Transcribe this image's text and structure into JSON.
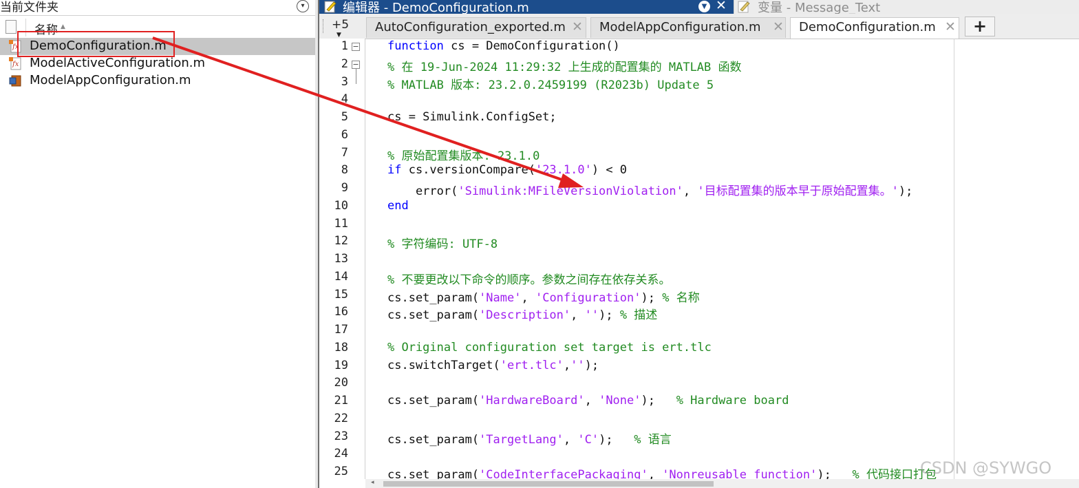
{
  "file_browser": {
    "title": "当前文件夹",
    "column_name": "名称",
    "files": [
      {
        "name": "DemoConfiguration.m",
        "icon": "matlab-function-icon",
        "selected": true
      },
      {
        "name": "ModelActiveConfiguration.m",
        "icon": "matlab-function-icon",
        "selected": false
      },
      {
        "name": "ModelAppConfiguration.m",
        "icon": "matlab-class-icon",
        "selected": false
      }
    ]
  },
  "editor": {
    "title": "编辑器 - DemoConfiguration.m",
    "variable_panel_title": "变量 - Message_Text",
    "more_tabs": "+5",
    "tabs": [
      {
        "label": "AutoConfiguration_exported.m",
        "active": false
      },
      {
        "label": "ModelAppConfiguration.m",
        "active": false
      },
      {
        "label": "DemoConfiguration.m",
        "active": true
      }
    ],
    "add_tab": "+"
  },
  "code": {
    "lines": [
      {
        "n": "1",
        "parts": [
          {
            "c": "kw",
            "t": "function"
          },
          {
            "c": "",
            "t": " cs = DemoConfiguration()"
          }
        ]
      },
      {
        "n": "2",
        "parts": [
          {
            "c": "cm",
            "t": "% 在 19-Jun-2024 11:29:32 上生成的配置集的 MATLAB 函数"
          }
        ]
      },
      {
        "n": "3",
        "parts": [
          {
            "c": "cm",
            "t": "% MATLAB 版本: 23.2.0.2459199 (R2023b) Update 5"
          }
        ]
      },
      {
        "n": "4",
        "parts": []
      },
      {
        "n": "5",
        "parts": [
          {
            "c": "",
            "t": "cs = Simulink.ConfigSet;"
          }
        ]
      },
      {
        "n": "6",
        "parts": []
      },
      {
        "n": "7",
        "parts": [
          {
            "c": "cm",
            "t": "% 原始配置集版本: 23.1.0"
          }
        ]
      },
      {
        "n": "8",
        "parts": [
          {
            "c": "kw",
            "t": "if"
          },
          {
            "c": "",
            "t": " cs.versionCompare("
          },
          {
            "c": "st",
            "t": "'23.1.0'"
          },
          {
            "c": "",
            "t": ") < 0"
          }
        ]
      },
      {
        "n": "9",
        "parts": [
          {
            "c": "",
            "t": "    error("
          },
          {
            "c": "st",
            "t": "'Simulink:MFileVersionViolation'"
          },
          {
            "c": "",
            "t": ", "
          },
          {
            "c": "st",
            "t": "'目标配置集的版本早于原始配置集。'"
          },
          {
            "c": "",
            "t": ");"
          }
        ]
      },
      {
        "n": "10",
        "parts": [
          {
            "c": "kw",
            "t": "end"
          }
        ]
      },
      {
        "n": "11",
        "parts": []
      },
      {
        "n": "12",
        "parts": [
          {
            "c": "cm",
            "t": "% 字符编码: UTF-8"
          }
        ]
      },
      {
        "n": "13",
        "parts": []
      },
      {
        "n": "14",
        "parts": [
          {
            "c": "cm",
            "t": "% 不要更改以下命令的顺序。参数之间存在依存关系。"
          }
        ]
      },
      {
        "n": "15",
        "parts": [
          {
            "c": "",
            "t": "cs.set_param("
          },
          {
            "c": "st",
            "t": "'Name'"
          },
          {
            "c": "",
            "t": ", "
          },
          {
            "c": "st",
            "t": "'Configuration'"
          },
          {
            "c": "",
            "t": "); "
          },
          {
            "c": "cm",
            "t": "% 名称"
          }
        ]
      },
      {
        "n": "16",
        "parts": [
          {
            "c": "",
            "t": "cs.set_param("
          },
          {
            "c": "st",
            "t": "'Description'"
          },
          {
            "c": "",
            "t": ", "
          },
          {
            "c": "st",
            "t": "''"
          },
          {
            "c": "",
            "t": "); "
          },
          {
            "c": "cm",
            "t": "% 描述"
          }
        ]
      },
      {
        "n": "17",
        "parts": []
      },
      {
        "n": "18",
        "parts": [
          {
            "c": "cm",
            "t": "% Original configuration set target is ert.tlc"
          }
        ]
      },
      {
        "n": "19",
        "parts": [
          {
            "c": "",
            "t": "cs.switchTarget("
          },
          {
            "c": "st",
            "t": "'ert.tlc'"
          },
          {
            "c": "",
            "t": ","
          },
          {
            "c": "st",
            "t": "''"
          },
          {
            "c": "",
            "t": ");"
          }
        ]
      },
      {
        "n": "20",
        "parts": []
      },
      {
        "n": "21",
        "parts": [
          {
            "c": "",
            "t": "cs.set_param("
          },
          {
            "c": "st",
            "t": "'HardwareBoard'"
          },
          {
            "c": "",
            "t": ", "
          },
          {
            "c": "st",
            "t": "'None'"
          },
          {
            "c": "",
            "t": ");   "
          },
          {
            "c": "cm",
            "t": "% Hardware board"
          }
        ]
      },
      {
        "n": "22",
        "parts": []
      },
      {
        "n": "23",
        "parts": [
          {
            "c": "",
            "t": "cs.set_param("
          },
          {
            "c": "st",
            "t": "'TargetLang'"
          },
          {
            "c": "",
            "t": ", "
          },
          {
            "c": "st",
            "t": "'C'"
          },
          {
            "c": "",
            "t": ");   "
          },
          {
            "c": "cm",
            "t": "% 语言"
          }
        ]
      },
      {
        "n": "24",
        "parts": []
      },
      {
        "n": "25",
        "parts": [
          {
            "c": "",
            "t": "cs.set_param("
          },
          {
            "c": "st",
            "t": "'CodeInterfacePackaging'"
          },
          {
            "c": "",
            "t": ", "
          },
          {
            "c": "st",
            "t": "'Nonreusable function'"
          },
          {
            "c": "",
            "t": ");   "
          },
          {
            "c": "cm",
            "t": "% 代码接口打包"
          }
        ]
      }
    ]
  },
  "watermark": "CSDN @SYWGO",
  "colors": {
    "keyword": "#0000ff",
    "comment": "#228b22",
    "string": "#a020f0",
    "annotation": "#e02020",
    "title_bar": "#1c4d8c"
  }
}
